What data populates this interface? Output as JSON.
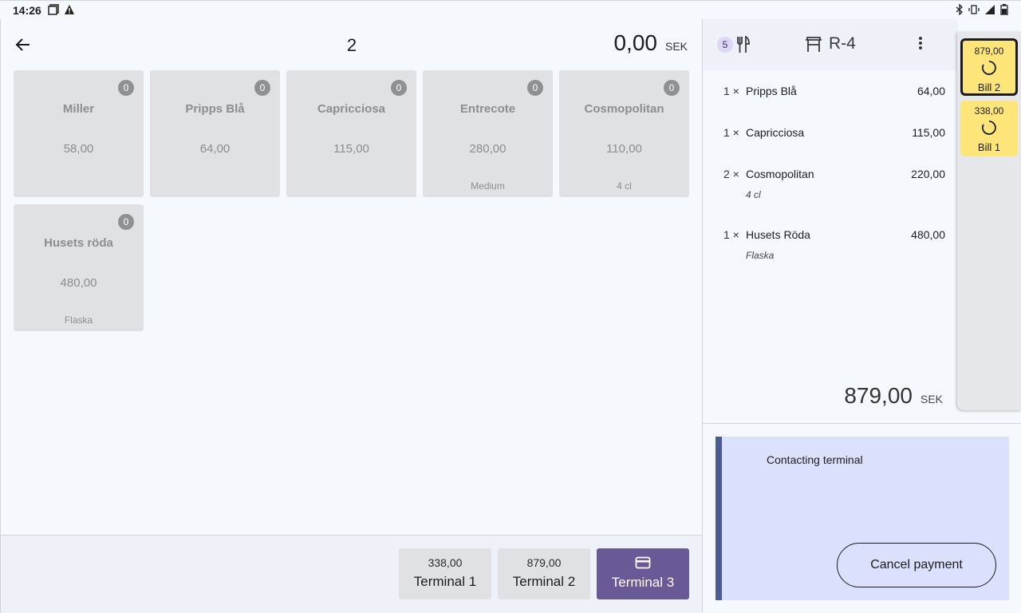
{
  "status_bar": {
    "time": "14:26",
    "left_icons": [
      "copy-icon",
      "warning-icon"
    ],
    "right_icons": [
      "bluetooth-icon",
      "vibrate-icon",
      "signal-icon",
      "battery-icon"
    ]
  },
  "header": {
    "order_number": "2",
    "total_amount": "0,00",
    "currency": "SEK"
  },
  "products": [
    {
      "name": "Miller",
      "price": "58,00",
      "count": "0",
      "note": ""
    },
    {
      "name": "Pripps Blå",
      "price": "64,00",
      "count": "0",
      "note": ""
    },
    {
      "name": "Capricciosa",
      "price": "115,00",
      "count": "0",
      "note": ""
    },
    {
      "name": "Entrecote",
      "price": "280,00",
      "count": "0",
      "note": "Medium"
    },
    {
      "name": "Cosmopolitan",
      "price": "110,00",
      "count": "0",
      "note": "4 cl"
    },
    {
      "name": "Husets röda",
      "price": "480,00",
      "count": "0",
      "note": "Flaska"
    }
  ],
  "terminals": [
    {
      "amount": "338,00",
      "label": "Terminal 1",
      "active": false
    },
    {
      "amount": "879,00",
      "label": "Terminal 2",
      "active": false
    },
    {
      "amount": "",
      "label": "Terminal 3",
      "active": true,
      "icon": "card-icon"
    }
  ],
  "order": {
    "guests": "5",
    "table": "R-4",
    "lines": [
      {
        "qty": "1 ×",
        "name": "Pripps Blå",
        "price": "64,00",
        "modifier": ""
      },
      {
        "qty": "1 ×",
        "name": "Capricciosa",
        "price": "115,00",
        "modifier": ""
      },
      {
        "qty": "2 ×",
        "name": "Cosmopolitan",
        "price": "220,00",
        "modifier": "4 cl"
      },
      {
        "qty": "1 ×",
        "name": "Husets Röda",
        "price": "480,00",
        "modifier": "Flaska"
      }
    ],
    "total": "879,00",
    "currency": "SEK"
  },
  "bills": [
    {
      "amount": "879,00",
      "label": "Bill 2",
      "selected": true
    },
    {
      "amount": "338,00",
      "label": "Bill 1",
      "selected": false
    }
  ],
  "payment": {
    "message": "Contacting terminal",
    "cancel_label": "Cancel payment"
  },
  "colors": {
    "accent": "#695996",
    "bill_yellow": "#fde57a",
    "payment_panel": "#dbe1fc",
    "payment_accent": "#4b5b95"
  }
}
